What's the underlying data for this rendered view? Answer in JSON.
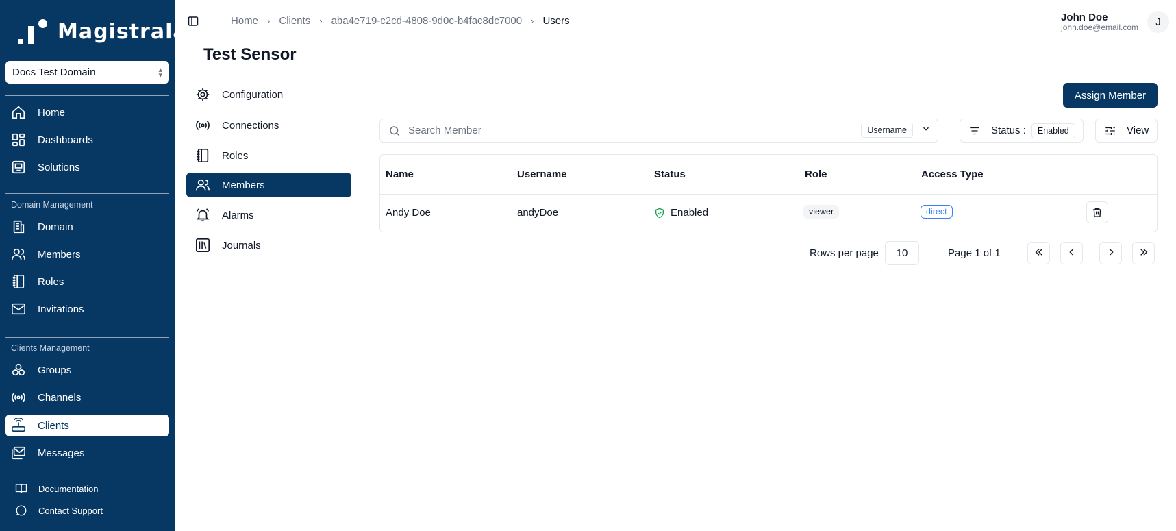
{
  "app": {
    "brand": "Magistrala"
  },
  "sidebar": {
    "domain": "Docs Test Domain",
    "main_items": [
      {
        "label": "Home",
        "icon": "home-icon"
      },
      {
        "label": "Dashboards",
        "icon": "dashboard-icon"
      },
      {
        "label": "Solutions",
        "icon": "solutions-icon"
      }
    ],
    "domain_section": "Domain Management",
    "domain_items": [
      {
        "label": "Domain",
        "icon": "building-icon"
      },
      {
        "label": "Members",
        "icon": "users-icon"
      },
      {
        "label": "Roles",
        "icon": "notebook-icon"
      },
      {
        "label": "Invitations",
        "icon": "mail-icon"
      }
    ],
    "clients_section": "Clients Management",
    "clients_items": [
      {
        "label": "Groups",
        "icon": "groups-icon"
      },
      {
        "label": "Channels",
        "icon": "radio-icon"
      },
      {
        "label": "Clients",
        "icon": "router-icon",
        "active": true
      },
      {
        "label": "Messages",
        "icon": "messages-icon"
      }
    ],
    "footer_items": [
      {
        "label": "Documentation",
        "icon": "book-icon"
      },
      {
        "label": "Contact Support",
        "icon": "chat-icon"
      }
    ]
  },
  "header": {
    "breadcrumb": [
      "Home",
      "Clients",
      "aba4e719-c2cd-4808-9d0c-b4fac8dc7000",
      "Users"
    ],
    "user_name": "John Doe",
    "user_email": "john.doe@email.com",
    "avatar_initial": "J"
  },
  "page": {
    "title": "Test Sensor"
  },
  "subnav": [
    {
      "label": "Configuration",
      "icon": "gear-icon"
    },
    {
      "label": "Connections",
      "icon": "radio-icon"
    },
    {
      "label": "Roles",
      "icon": "notebook-icon"
    },
    {
      "label": "Members",
      "icon": "users-icon",
      "active": true
    },
    {
      "label": "Alarms",
      "icon": "bell-icon"
    },
    {
      "label": "Journals",
      "icon": "library-icon"
    }
  ],
  "toolbar": {
    "assign_label": "Assign Member",
    "search_placeholder": "Search Member",
    "search_field": "Username",
    "status_label": "Status :",
    "status_value": "Enabled",
    "view_label": "View"
  },
  "table": {
    "columns": [
      "Name",
      "Username",
      "Status",
      "Role",
      "Access Type"
    ],
    "rows": [
      {
        "name": "Andy Doe",
        "username": "andyDoe",
        "status": "Enabled",
        "role": "viewer",
        "access_type": "direct"
      }
    ]
  },
  "pagination": {
    "rows_per_page_label": "Rows per page",
    "rows_per_page": "10",
    "page_text": "Page 1 of 1"
  },
  "colors": {
    "brand": "#073763",
    "access_badge": "#3b82f6",
    "status_icon": "#16a34a"
  }
}
